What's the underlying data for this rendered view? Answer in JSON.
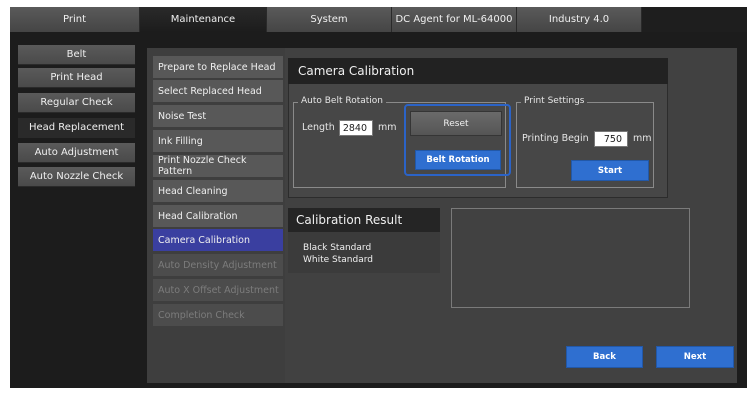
{
  "tabs": [
    {
      "label": "Print"
    },
    {
      "label": "Maintenance"
    },
    {
      "label": "System"
    },
    {
      "label": "DC Agent for ML-64000"
    },
    {
      "label": "Industry 4.0"
    }
  ],
  "categories": [
    {
      "label": "Belt"
    },
    {
      "label": "Print Head"
    },
    {
      "label": "Regular Check"
    },
    {
      "label": "Head Replacement"
    },
    {
      "label": "Auto Adjustment"
    },
    {
      "label": "Auto Nozzle Check"
    }
  ],
  "steps": [
    {
      "label": "Prepare to Replace Head"
    },
    {
      "label": "Select Replaced Head"
    },
    {
      "label": "Noise Test"
    },
    {
      "label": "Ink Filling"
    },
    {
      "label": "Print Nozzle Check Pattern"
    },
    {
      "label": "Head Cleaning"
    },
    {
      "label": "Head Calibration"
    },
    {
      "label": "Camera Calibration"
    },
    {
      "label": "Auto Density Adjustment"
    },
    {
      "label": "Auto X Offset Adjustment"
    },
    {
      "label": "Completion Check"
    }
  ],
  "camera_calibration": {
    "title": "Camera Calibration",
    "auto_belt_rotation": {
      "group_label": "Auto Belt Rotation",
      "length_label": "Length",
      "length_value": "2840",
      "length_unit": "mm",
      "reset_label": "Reset",
      "belt_rotation_label": "Belt Rotation"
    },
    "print_settings": {
      "group_label": "Print Settings",
      "printing_begin_label": "Printing Begin",
      "printing_begin_value": "750",
      "unit": "mm",
      "start_label": "Start"
    }
  },
  "calibration_result": {
    "title": "Calibration Result",
    "items": [
      "Black Standard",
      "White Standard"
    ]
  },
  "footer": {
    "back_label": "Back",
    "next_label": "Next"
  },
  "colors": {
    "accent_blue": "#2f6fd0",
    "active_step": "#3a3fa0",
    "highlight": "#2b63c7"
  }
}
